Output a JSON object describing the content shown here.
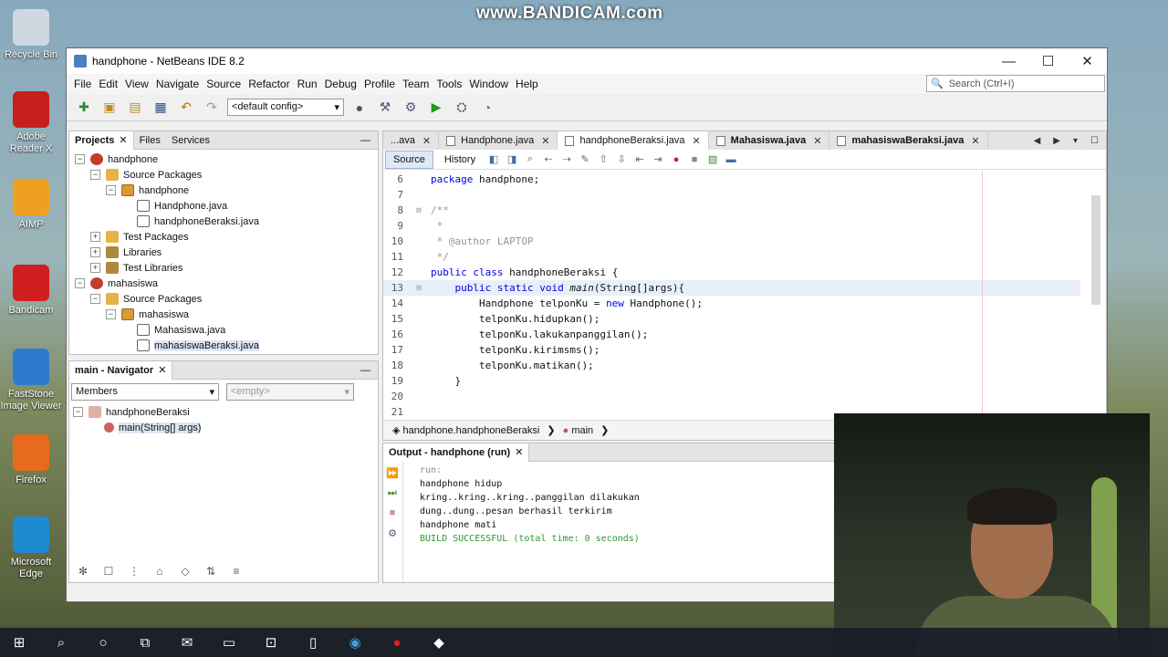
{
  "watermark": "www.BANDICAM.com",
  "desktop_icons": [
    {
      "label": "Recycle Bin",
      "icon": "recycle-bin-icon",
      "color": "#cfd8e0"
    },
    {
      "label": "Adobe Reader X",
      "icon": "adobe-reader-icon",
      "color": "#c81e1e"
    },
    {
      "label": "AIMP",
      "icon": "aimp-icon",
      "color": "#f0a020"
    },
    {
      "label": "Bandicam",
      "icon": "bandicam-icon",
      "color": "#d21e1e"
    },
    {
      "label": "FastStone Image Viewer",
      "icon": "faststone-icon",
      "color": "#2e7ad0"
    },
    {
      "label": "Firefox",
      "icon": "firefox-icon",
      "color": "#e86a1c"
    },
    {
      "label": "Microsoft Edge",
      "icon": "edge-icon",
      "color": "#1e8ad0"
    }
  ],
  "window": {
    "title": "handphone - NetBeans IDE 8.2",
    "controls": [
      "—",
      "☐",
      "✕"
    ]
  },
  "menu": [
    "File",
    "Edit",
    "View",
    "Navigate",
    "Source",
    "Refactor",
    "Run",
    "Debug",
    "Profile",
    "Team",
    "Tools",
    "Window",
    "Help"
  ],
  "search_placeholder": "Search (Ctrl+I)",
  "config": "<default config>",
  "projects_panel": {
    "tabs": [
      "Projects",
      "Files",
      "Services"
    ],
    "tree": [
      {
        "label": "handphone",
        "level": 0,
        "icon": "proj",
        "expander": "−"
      },
      {
        "label": "Source Packages",
        "level": 1,
        "icon": "pkgs",
        "expander": "−"
      },
      {
        "label": "handphone",
        "level": 2,
        "icon": "pkg",
        "expander": "−"
      },
      {
        "label": "Handphone.java",
        "level": 3,
        "icon": "jf",
        "expander": ""
      },
      {
        "label": "handphoneBeraksi.java",
        "level": 3,
        "icon": "jf",
        "expander": ""
      },
      {
        "label": "Test Packages",
        "level": 1,
        "icon": "pkgs",
        "expander": "+"
      },
      {
        "label": "Libraries",
        "level": 1,
        "icon": "lib",
        "expander": "+"
      },
      {
        "label": "Test Libraries",
        "level": 1,
        "icon": "lib",
        "expander": "+"
      },
      {
        "label": "mahasiswa",
        "level": 0,
        "icon": "proj",
        "expander": "−"
      },
      {
        "label": "Source Packages",
        "level": 1,
        "icon": "pkgs",
        "expander": "−"
      },
      {
        "label": "mahasiswa",
        "level": 2,
        "icon": "pkg",
        "expander": "−"
      },
      {
        "label": "Mahasiswa.java",
        "level": 3,
        "icon": "jf",
        "expander": ""
      },
      {
        "label": "mahasiswaBeraksi.java",
        "level": 3,
        "icon": "jf",
        "expander": "",
        "selected": true
      }
    ]
  },
  "navigator": {
    "title": "main - Navigator",
    "members_label": "Members",
    "filter_placeholder": "<empty>",
    "class_name": "handphoneBeraksi",
    "method": "main(String[] args)"
  },
  "editor": {
    "tabs": [
      {
        "label": "...ava",
        "active": false,
        "bold": false
      },
      {
        "label": "Handphone.java",
        "active": false,
        "bold": false
      },
      {
        "label": "handphoneBeraksi.java",
        "active": true,
        "bold": false
      },
      {
        "label": "Mahasiswa.java",
        "active": false,
        "bold": true
      },
      {
        "label": "mahasiswaBeraksi.java",
        "active": false,
        "bold": true
      }
    ],
    "source_tab": "Source",
    "history_tab": "History",
    "current_line": 13,
    "lines": [
      {
        "n": 6,
        "fold": "",
        "segments": [
          {
            "t": "package",
            "c": "kw"
          },
          {
            "t": " handphone;",
            "c": ""
          }
        ]
      },
      {
        "n": 7,
        "fold": "",
        "segments": []
      },
      {
        "n": 8,
        "fold": "⊟",
        "segments": [
          {
            "t": "/**",
            "c": "cm"
          }
        ]
      },
      {
        "n": 9,
        "fold": "",
        "segments": [
          {
            "t": " *",
            "c": "cm"
          }
        ]
      },
      {
        "n": 10,
        "fold": "",
        "segments": [
          {
            "t": " * @author LAPTOP",
            "c": "cm"
          }
        ]
      },
      {
        "n": 11,
        "fold": "",
        "segments": [
          {
            "t": " */",
            "c": "cm"
          }
        ]
      },
      {
        "n": 12,
        "fold": "",
        "segments": [
          {
            "t": "public class",
            "c": "kw"
          },
          {
            "t": " handphoneBeraksi {",
            "c": ""
          }
        ]
      },
      {
        "n": 13,
        "fold": "⊟",
        "segments": [
          {
            "t": "    ",
            "c": ""
          },
          {
            "t": "public static void",
            "c": "kw"
          },
          {
            "t": " ",
            "c": ""
          },
          {
            "t": "main",
            "c": "ital"
          },
          {
            "t": "(String[]args){",
            "c": ""
          }
        ]
      },
      {
        "n": 14,
        "fold": "",
        "segments": [
          {
            "t": "        Handphone telponKu = ",
            "c": ""
          },
          {
            "t": "new",
            "c": "kw"
          },
          {
            "t": " Handphone();",
            "c": ""
          }
        ]
      },
      {
        "n": 15,
        "fold": "",
        "segments": [
          {
            "t": "        telponKu.hidupkan();",
            "c": ""
          }
        ]
      },
      {
        "n": 16,
        "fold": "",
        "segments": [
          {
            "t": "        telponKu.lakukanpanggilan();",
            "c": ""
          }
        ]
      },
      {
        "n": 17,
        "fold": "",
        "segments": [
          {
            "t": "        telponKu.kirimsms();",
            "c": ""
          }
        ]
      },
      {
        "n": 18,
        "fold": "",
        "segments": [
          {
            "t": "        telponKu.matikan();",
            "c": ""
          }
        ]
      },
      {
        "n": 19,
        "fold": "",
        "segments": [
          {
            "t": "    }",
            "c": ""
          }
        ]
      },
      {
        "n": 20,
        "fold": "",
        "segments": []
      },
      {
        "n": 21,
        "fold": "",
        "segments": []
      }
    ],
    "breadcrumb": [
      "handphone.handphoneBeraksi",
      "main"
    ]
  },
  "output": {
    "title": "Output - handphone (run)",
    "lines": [
      {
        "t": "run:",
        "c": "dim"
      },
      {
        "t": "handphone hidup",
        "c": ""
      },
      {
        "t": "kring..kring..kring..panggilan dilakukan",
        "c": ""
      },
      {
        "t": "dung..dung..pesan berhasil terkirim",
        "c": ""
      },
      {
        "t": "handphone mati",
        "c": ""
      },
      {
        "t": "BUILD SUCCESSFUL (total time: 0 seconds)",
        "c": "ok"
      }
    ]
  },
  "taskbar": [
    "windows-start-icon",
    "search-icon",
    "cortana-icon",
    "task-view-icon",
    "mail-icon",
    "file-explorer-icon",
    "store-icon",
    "file-icon",
    "edge-icon",
    "bandicam-icon",
    "netbeans-icon"
  ]
}
